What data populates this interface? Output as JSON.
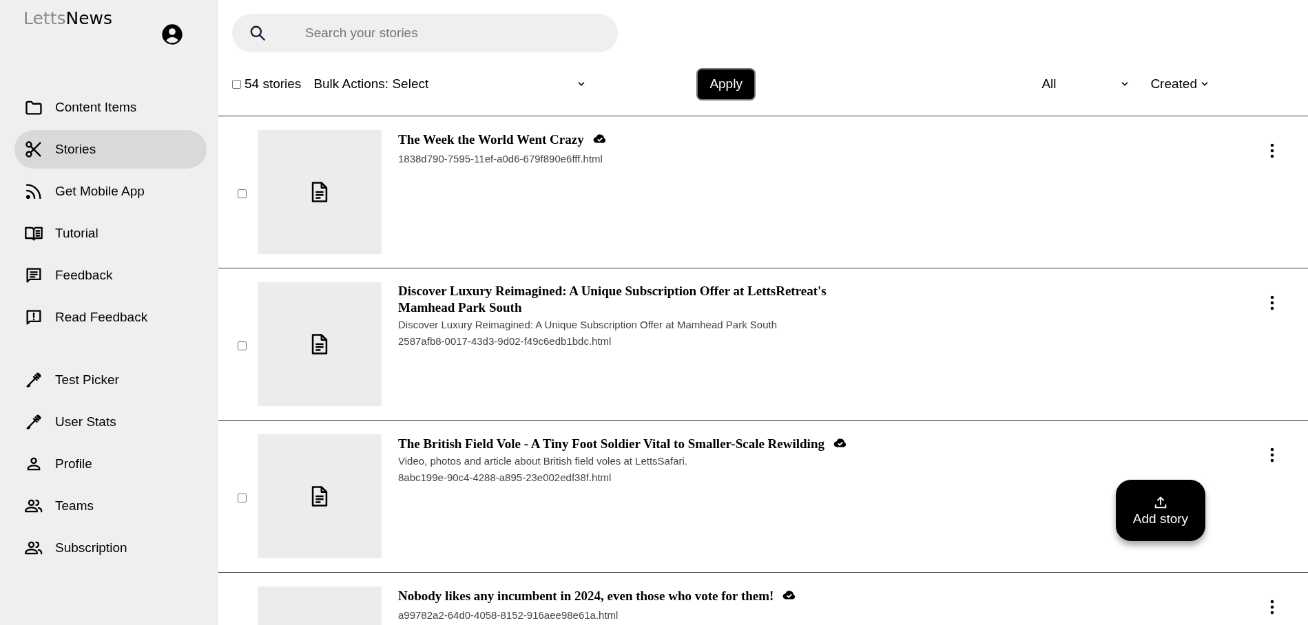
{
  "logo": {
    "light": "Letts",
    "dark": "News"
  },
  "sidebar": {
    "groups": [
      [
        {
          "label": "Content Items",
          "selected": false
        },
        {
          "label": "Stories",
          "selected": true
        },
        {
          "label": "Get Mobile App",
          "selected": false
        },
        {
          "label": "Tutorial",
          "selected": false
        },
        {
          "label": "Feedback",
          "selected": false
        },
        {
          "label": "Read Feedback",
          "selected": false
        }
      ],
      [
        {
          "label": "Test Picker",
          "selected": false
        },
        {
          "label": "User Stats",
          "selected": false
        },
        {
          "label": "Profile",
          "selected": false
        },
        {
          "label": "Teams",
          "selected": false
        },
        {
          "label": "Subscription",
          "selected": false
        }
      ]
    ]
  },
  "search": {
    "placeholder": "Search your stories"
  },
  "toolbar": {
    "select_all": {
      "label": "54 stories",
      "checked": false
    },
    "bulk_actions": "Bulk Actions: Select",
    "apply": "Apply",
    "filter": "All",
    "sort": "Created"
  },
  "stories": [
    {
      "title": "The Week the World Went Crazy",
      "filename": "1838d790-7595-11ef-a0d6-679f890e6fff.html",
      "synced": true,
      "checked": false
    },
    {
      "title": "Discover Luxury Reimagined: A Unique Subscription Offer at LettsRetreat's Mamhead Park South",
      "description": "Discover Luxury Reimagined: A Unique Subscription Offer at Mamhead Park South",
      "filename": "2587afb8-0017-43d3-9d02-f49c6edb1bdc.html",
      "synced": false,
      "checked": false
    },
    {
      "title": "The British Field Vole - A Tiny Foot Soldier Vital to Smaller-Scale Rewilding",
      "description": "Video, photos and article about British field voles at LettsSafari.",
      "filename": "8abc199e-90c4-4288-a895-23e002edf38f.html",
      "synced": true,
      "checked": false
    },
    {
      "title": "Nobody likes any incumbent in 2024, even those who vote for them!",
      "filename": "a99782a2-64d0-4058-8152-916aee98e61a.html",
      "synced": true
    }
  ],
  "add_button": {
    "label": "Add story"
  }
}
